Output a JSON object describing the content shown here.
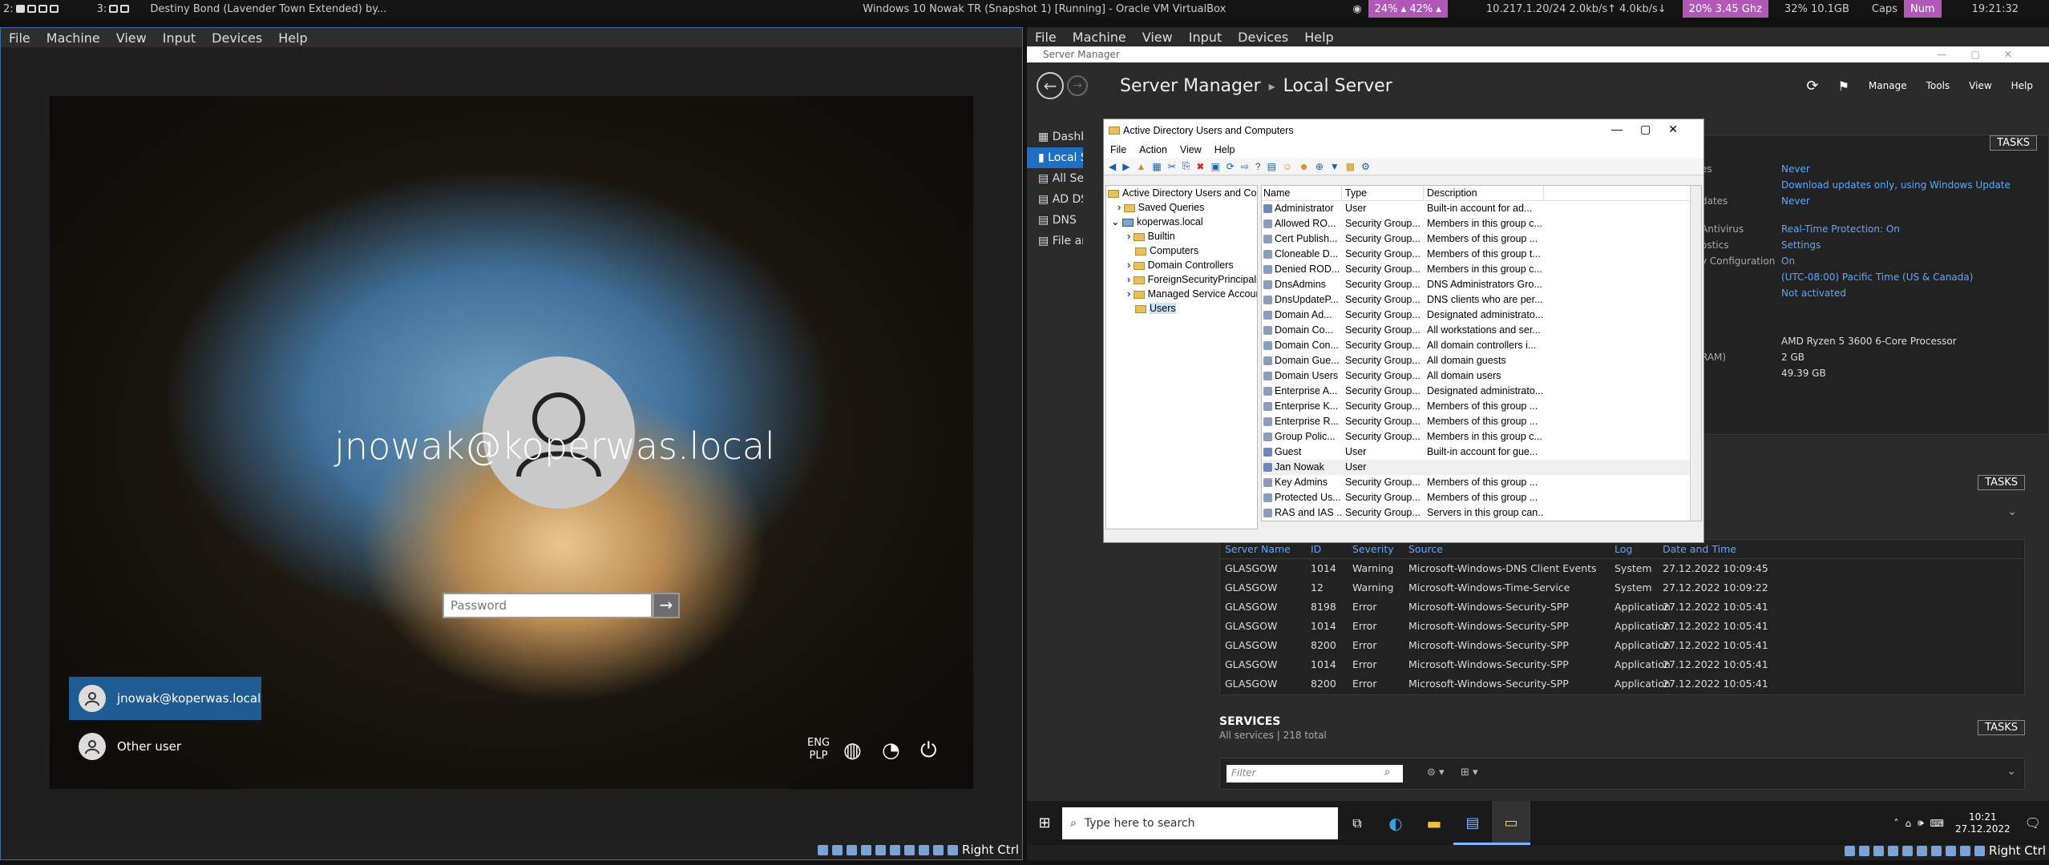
{
  "topbar": {
    "ws1": "2:",
    "ws2": "3:",
    "song": "Destiny Bond (Lavender Town Extended) by...",
    "vbox_title": "Windows 10 Nowak TR (Snapshot 1) [Running] - Oracle VM VirtualBox",
    "battery": "24% ▴ 42% ▴",
    "network": "10.217.1.20/24 2.0kb/s↑ 4.0kb/s↓",
    "cpu": "20% 3.45 Ghz",
    "mem": "32% 10.1GB",
    "caps": "Caps",
    "num": "Num",
    "clock": "19:21:32",
    "colors": {
      "purple": "#b057b7",
      "dark": "#141414"
    }
  },
  "left_vm": {
    "menu": [
      "File",
      "Machine",
      "View",
      "Input",
      "Devices",
      "Help"
    ],
    "login": {
      "username": "jnowak@koperwas.local",
      "password_placeholder": "Password",
      "users": [
        "jnowak@koperwas.local",
        "Other user"
      ],
      "lang": "ENG",
      "layout": "PLP"
    },
    "host_key": "Right Ctrl"
  },
  "right_vm": {
    "menu": [
      "File",
      "Machine",
      "View",
      "Input",
      "Devices",
      "Help"
    ],
    "sm_title": "Server Manager",
    "breadcrumb_root": "Server Manager",
    "breadcrumb_page": "Local Server",
    "top_menu": [
      "Manage",
      "Tools",
      "View",
      "Help"
    ],
    "nav": [
      "Dashboard",
      "Local Server",
      "All Servers",
      "AD DS",
      "DNS",
      "File and Storage Services"
    ],
    "props": [
      {
        "label": "es",
        "value": "Never"
      },
      {
        "label": "",
        "value": "Download updates only, using Windows Update"
      },
      {
        "label": "dates",
        "value": "Never"
      },
      {
        "label": "Antivirus",
        "value": "Real-Time Protection: On"
      },
      {
        "label": "ostics",
        "value": "Settings"
      },
      {
        "label": "y Configuration",
        "value": "On"
      },
      {
        "label": "",
        "value": "(UTC-08:00) Pacific Time (US & Canada)"
      },
      {
        "label": "",
        "value": "Not activated"
      },
      {
        "label": "",
        "value": "AMD Ryzen 5 3600 6-Core Processor"
      },
      {
        "label": "RAM)",
        "value": "2 GB"
      },
      {
        "label": "",
        "value": "49.39 GB"
      }
    ],
    "tasks": "TASKS",
    "events": {
      "headers": [
        "Server Name",
        "ID",
        "Severity",
        "Source",
        "Log",
        "Date and Time"
      ],
      "rows": [
        [
          "GLASGOW",
          "1014",
          "Warning",
          "Microsoft-Windows-DNS Client Events",
          "System",
          "27.12.2022 10:09:45"
        ],
        [
          "GLASGOW",
          "12",
          "Warning",
          "Microsoft-Windows-Time-Service",
          "System",
          "27.12.2022 10:09:22"
        ],
        [
          "GLASGOW",
          "8198",
          "Error",
          "Microsoft-Windows-Security-SPP",
          "Application",
          "27.12.2022 10:05:41"
        ],
        [
          "GLASGOW",
          "1014",
          "Error",
          "Microsoft-Windows-Security-SPP",
          "Application",
          "27.12.2022 10:05:41"
        ],
        [
          "GLASGOW",
          "8200",
          "Error",
          "Microsoft-Windows-Security-SPP",
          "Application",
          "27.12.2022 10:05:41"
        ],
        [
          "GLASGOW",
          "1014",
          "Error",
          "Microsoft-Windows-Security-SPP",
          "Application",
          "27.12.2022 10:05:41"
        ],
        [
          "GLASGOW",
          "8200",
          "Error",
          "Microsoft-Windows-Security-SPP",
          "Application",
          "27.12.2022 10:05:41"
        ]
      ]
    },
    "services": {
      "title": "SERVICES",
      "subtitle": "All services | 218 total",
      "filter_placeholder": "Filter"
    },
    "taskbar": {
      "search": "Type here to search",
      "time": "10:21",
      "date": "27.12.2022"
    },
    "host_key": "Right Ctrl"
  },
  "ad": {
    "title": "Active Directory Users and Computers",
    "menu": [
      "File",
      "Action",
      "View",
      "Help"
    ],
    "tree": [
      "Active Directory Users and Com",
      "Saved Queries",
      "koperwas.local",
      "Builtin",
      "Computers",
      "Domain Controllers",
      "ForeignSecurityPrincipals",
      "Managed Service Accoun",
      "Users"
    ],
    "headers": [
      "Name",
      "Type",
      "Description"
    ],
    "rows": [
      [
        "Administrator",
        "User",
        "Built-in account for ad..."
      ],
      [
        "Allowed RO...",
        "Security Group...",
        "Members in this group c..."
      ],
      [
        "Cert Publish...",
        "Security Group...",
        "Members of this group ..."
      ],
      [
        "Cloneable D...",
        "Security Group...",
        "Members of this group t..."
      ],
      [
        "Denied ROD...",
        "Security Group...",
        "Members in this group c..."
      ],
      [
        "DnsAdmins",
        "Security Group...",
        "DNS Administrators Gro..."
      ],
      [
        "DnsUpdateP...",
        "Security Group...",
        "DNS clients who are per..."
      ],
      [
        "Domain Ad...",
        "Security Group...",
        "Designated administrato..."
      ],
      [
        "Domain Co...",
        "Security Group...",
        "All workstations and ser..."
      ],
      [
        "Domain Con...",
        "Security Group...",
        "All domain controllers i..."
      ],
      [
        "Domain Gue...",
        "Security Group...",
        "All domain guests"
      ],
      [
        "Domain Users",
        "Security Group...",
        "All domain users"
      ],
      [
        "Enterprise A...",
        "Security Group...",
        "Designated administrato..."
      ],
      [
        "Enterprise K...",
        "Security Group...",
        "Members of this group ..."
      ],
      [
        "Enterprise R...",
        "Security Group...",
        "Members of this group ..."
      ],
      [
        "Group Polic...",
        "Security Group...",
        "Members in this group c..."
      ],
      [
        "Guest",
        "User",
        "Built-in account for gue..."
      ],
      [
        "Jan Nowak",
        "User",
        ""
      ],
      [
        "Key Admins",
        "Security Group...",
        "Members of this group ..."
      ],
      [
        "Protected Us...",
        "Security Group...",
        "Members of this group ..."
      ],
      [
        "RAS and IAS ...",
        "Security Group...",
        "Servers in this group can..."
      ]
    ]
  }
}
